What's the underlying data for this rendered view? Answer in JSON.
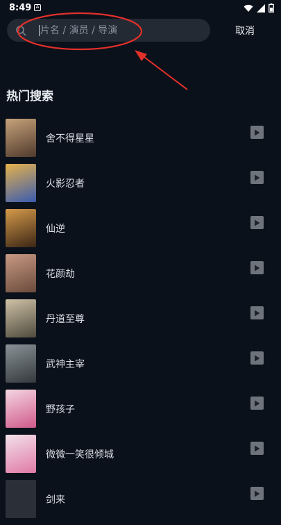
{
  "status_bar": {
    "time": "8:49",
    "notification_glyph": "A"
  },
  "search": {
    "placeholder": "片名 / 演员 / 导演",
    "value": ""
  },
  "cancel_label": "取消",
  "section_title": "热门搜索",
  "hot_list": [
    {
      "title": "舍不得星星",
      "poster_colors": [
        "#c7a27a",
        "#4f3a2c"
      ]
    },
    {
      "title": "火影忍者",
      "poster_colors": [
        "#e6b24b",
        "#3a5bb0"
      ]
    },
    {
      "title": "仙逆",
      "poster_colors": [
        "#d59a4a",
        "#3b2615"
      ]
    },
    {
      "title": "花颜劫",
      "poster_colors": [
        "#c79a83",
        "#6b4a3c"
      ]
    },
    {
      "title": "丹道至尊",
      "poster_colors": [
        "#cfc2a6",
        "#4f4a3e"
      ]
    },
    {
      "title": "武神主宰",
      "poster_colors": [
        "#8a9296",
        "#33393d"
      ]
    },
    {
      "title": "野孩子",
      "poster_colors": [
        "#f4d6e2",
        "#d05a8a"
      ]
    },
    {
      "title": "微微一笑很倾城",
      "poster_colors": [
        "#f2e1ea",
        "#e07aa6"
      ]
    },
    {
      "title": "剑来",
      "poster_colors": [
        "#2b3038",
        "#2b3038"
      ]
    }
  ],
  "colors": {
    "background": "#0b111b",
    "annotation": "#e2302a",
    "play_button": "#6e747c"
  }
}
